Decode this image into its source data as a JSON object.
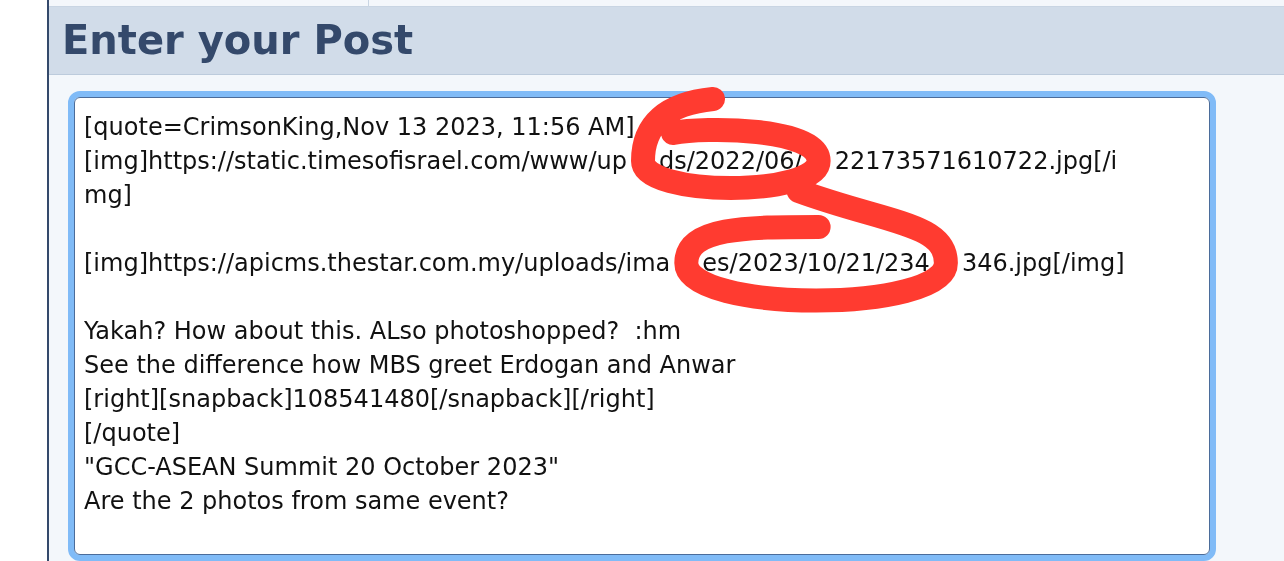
{
  "heading": "Enter your Post",
  "post_field": {
    "lines": [
      {
        "kind": "text",
        "segments": [
          "[quote=CrimsonKing,Nov 13 2023, 11:56 AM]"
        ]
      },
      {
        "kind": "text",
        "segments": [
          "[img]https://static.timesofisrael.com/www/up",
          "ds/2022/06/",
          "22173571610722.jpg[/i"
        ]
      },
      {
        "kind": "text",
        "segments": [
          "mg]"
        ]
      },
      {
        "kind": "blank"
      },
      {
        "kind": "text",
        "segments": [
          "[img]https://apicms.thestar.com.my/uploads/ima",
          "es/2023/10/21/234",
          "346.jpg[/img]"
        ]
      },
      {
        "kind": "blank"
      },
      {
        "kind": "text",
        "segments": [
          "Yakah? How about this. ALso photoshopped?  :hm"
        ]
      },
      {
        "kind": "text",
        "segments": [
          "See the difference how MBS greet Erdogan and Anwar"
        ]
      },
      {
        "kind": "text",
        "segments": [
          "[right][snapback]108541480[/snapback][/right]"
        ]
      },
      {
        "kind": "text",
        "segments": [
          "[/quote]"
        ]
      },
      {
        "kind": "text",
        "segments": [
          "\"GCC-ASEAN Summit 20 October 2023\""
        ]
      },
      {
        "kind": "text",
        "segments": [
          "Are the 2 photos from same event?"
        ]
      }
    ]
  }
}
